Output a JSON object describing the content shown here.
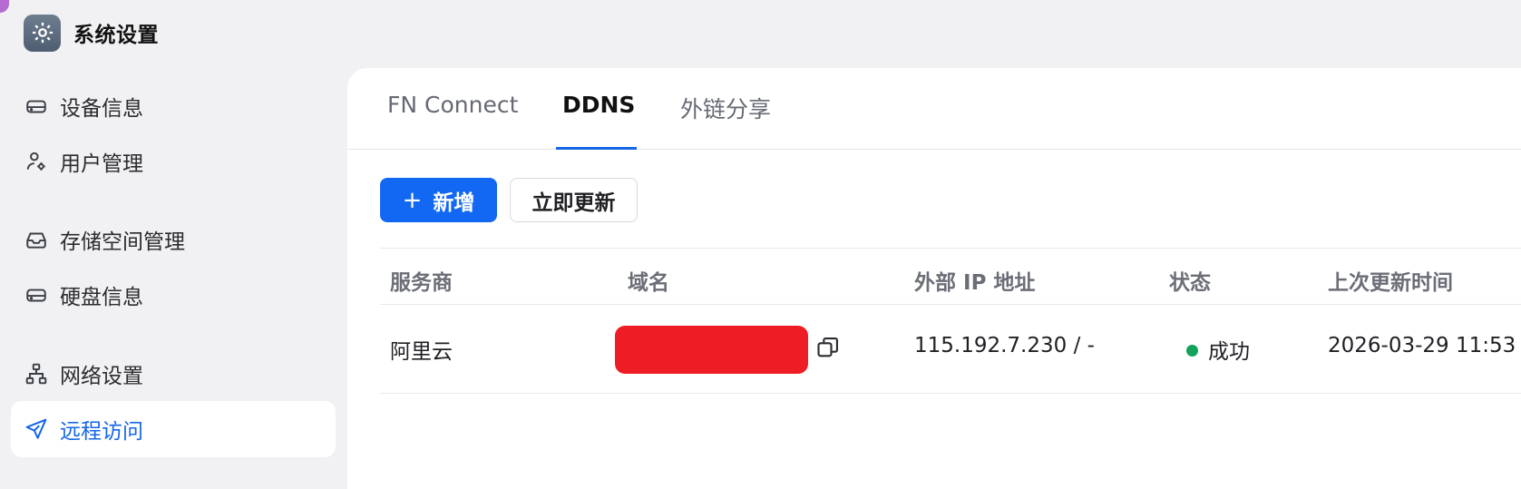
{
  "app": {
    "title": "系统设置",
    "icon": "gear-icon"
  },
  "sidebar": {
    "items": [
      {
        "label": "设备信息",
        "icon": "device-icon",
        "active": false
      },
      {
        "label": "用户管理",
        "icon": "user-settings-icon",
        "active": false
      },
      {
        "label": "存储空间管理",
        "icon": "storage-icon",
        "active": false
      },
      {
        "label": "硬盘信息",
        "icon": "disk-icon",
        "active": false
      },
      {
        "label": "网络设置",
        "icon": "network-icon",
        "active": false
      },
      {
        "label": "远程访问",
        "icon": "send-icon",
        "active": true
      }
    ]
  },
  "tabs": [
    {
      "label": "FN Connect",
      "active": false
    },
    {
      "label": "DDNS",
      "active": true
    },
    {
      "label": "外链分享",
      "active": false
    }
  ],
  "toolbar": {
    "add_label": "新增",
    "add_icon": "plus-icon",
    "update_label": "立即更新"
  },
  "table": {
    "headers": [
      "服务商",
      "域名",
      "外部 IP 地址",
      "状态",
      "上次更新时间"
    ],
    "rows": [
      {
        "provider": "阿里云",
        "domain_redacted": true,
        "external_ip": "115.192.7.230 / -",
        "status": "成功",
        "last_updated": "2026-03-29 11:53"
      }
    ]
  },
  "colors": {
    "accent": "#1268f3",
    "active_nav_text": "#1565e8",
    "status_success": "#11a35a",
    "redaction": "#ee1c25",
    "background": "#f1f1f3"
  }
}
